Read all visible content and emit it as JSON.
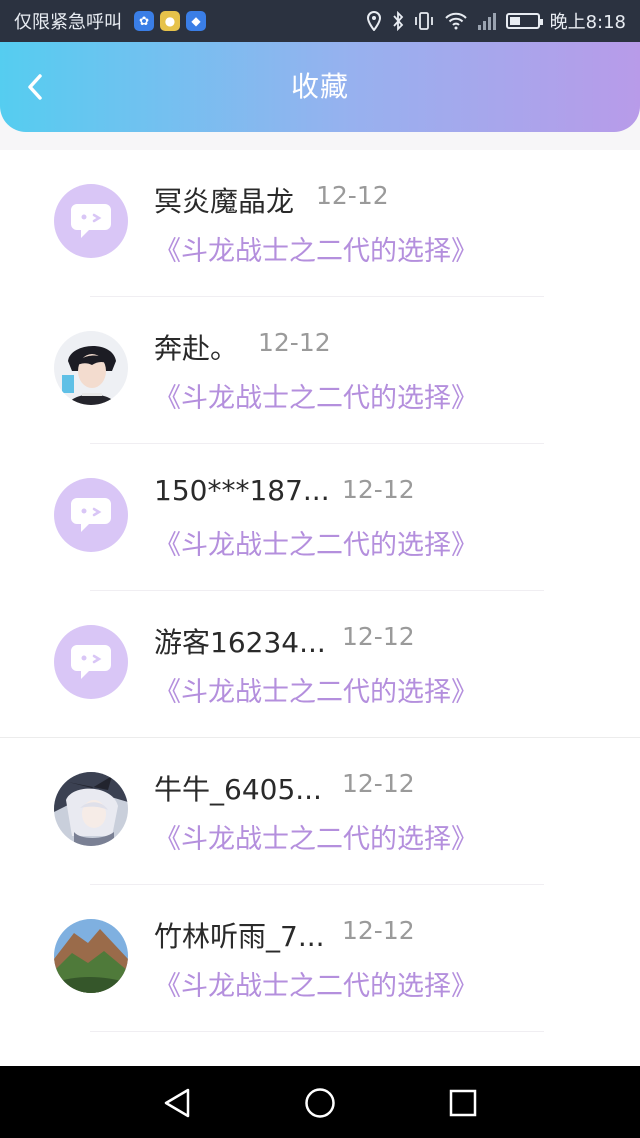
{
  "status_bar": {
    "carrier": "仅限紧急呼叫",
    "time": "晚上8:18",
    "icons": [
      "baidu-app-icon",
      "wechat-app-icon",
      "security-app-icon",
      "location-icon",
      "bluetooth-icon",
      "vibrate-icon",
      "wifi-icon",
      "signal-icon",
      "battery-icon"
    ]
  },
  "header": {
    "title": "收藏",
    "back_icon": "chevron-left-icon"
  },
  "favorites": [
    {
      "name": "冥炎魔晶龙",
      "date": "12-12",
      "book": "《斗龙战士之二代的选择》",
      "avatar": "placeholder"
    },
    {
      "name": "奔赴。",
      "date": "12-12",
      "book": "《斗龙战士之二代的选择》",
      "avatar": "photo-anime-boy"
    },
    {
      "name": "150***187...",
      "date": "12-12",
      "book": "《斗龙战士之二代的选择》",
      "avatar": "placeholder"
    },
    {
      "name": "游客16234...",
      "date": "12-12",
      "book": "《斗龙战士之二代的选择》",
      "avatar": "placeholder"
    },
    {
      "name": "牛牛_6405...",
      "date": "12-12",
      "book": "《斗龙战士之二代的选择》",
      "avatar": "photo-anime-girl"
    },
    {
      "name": "竹林听雨_7...",
      "date": "12-12",
      "book": "《斗龙战士之二代的选择》",
      "avatar": "photo-mountain"
    }
  ],
  "nav_bar": {
    "icons": [
      "back-triangle-icon",
      "home-circle-icon",
      "recents-square-icon"
    ]
  },
  "colors": {
    "accent": "#b48fdd",
    "header_start": "#55cdf0",
    "header_end": "#b89be9",
    "placeholder": "#d9c6f6"
  }
}
